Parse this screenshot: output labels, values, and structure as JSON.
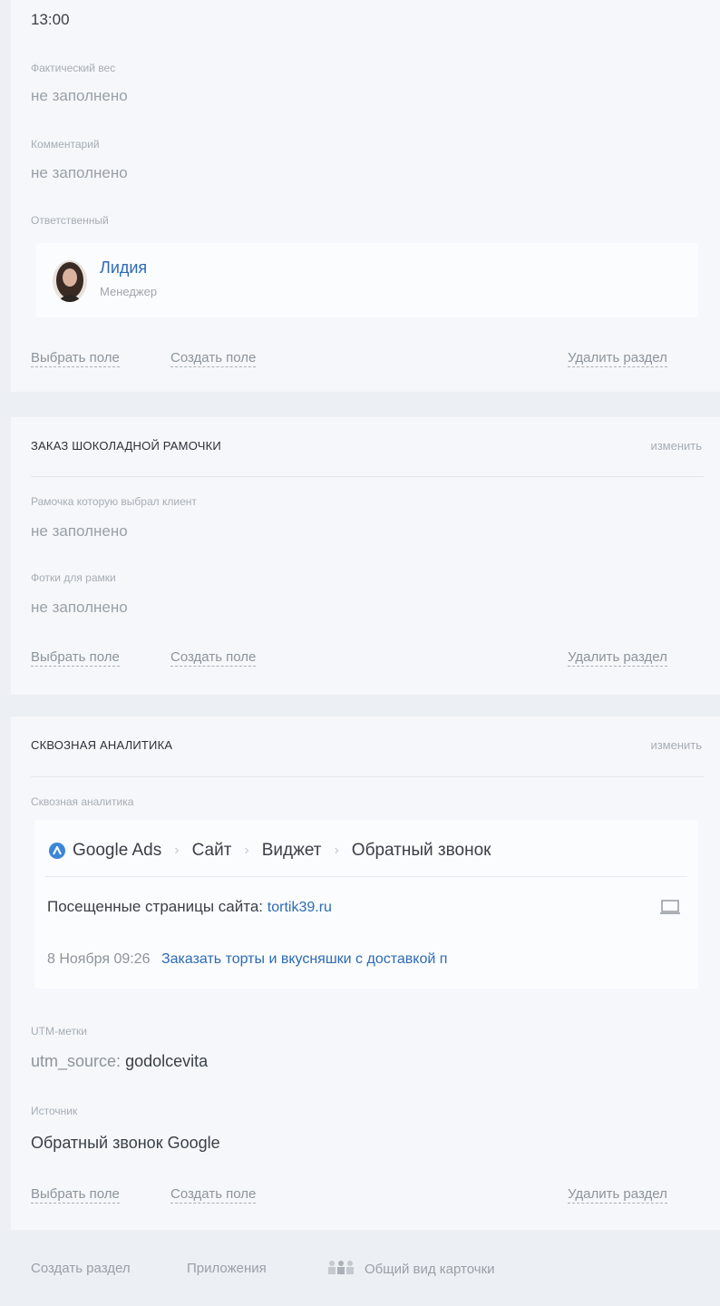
{
  "section_main": {
    "time": "13:00",
    "actual_weight_label": "Фактический вес",
    "actual_weight_value": "не заполнено",
    "comment_label": "Комментарий",
    "comment_value": "не заполнено",
    "responsible_label": "Ответственный",
    "responsible_name": "Лидия",
    "responsible_role": "Менеджер",
    "actions": {
      "select_field": "Выбрать поле",
      "create_field": "Создать поле",
      "delete_section": "Удалить раздел"
    }
  },
  "section_frame": {
    "title": "ЗАКАЗ ШОКОЛАДНОЙ РАМОЧКИ",
    "edit": "изменить",
    "frame_label": "Рамочка которую выбрал клиент",
    "frame_value": "не заполнено",
    "photo_label": "Фотки для рамки",
    "photo_value": "не заполнено",
    "actions": {
      "select_field": "Выбрать поле",
      "create_field": "Создать поле",
      "delete_section": "Удалить раздел"
    }
  },
  "section_analytics": {
    "title": "СКВОЗНАЯ АНАЛИТИКА",
    "edit": "изменить",
    "analytics_label": "Сквозная аналитика",
    "path": [
      "Google Ads",
      "Сайт",
      "Виджет",
      "Обратный звонок"
    ],
    "visited_pages_label": "Посещенные страницы сайта:",
    "visited_site": "tortik39.ru",
    "visit_time": "8 Ноября 09:26",
    "visit_page": "Заказать торты и вкусняшки с доставкой п",
    "utm_label": "UTM-метки",
    "utm_key": "utm_source:",
    "utm_value": "godolcevita",
    "source_label": "Источник",
    "source_value": "Обратный звонок Google",
    "actions": {
      "select_field": "Выбрать поле",
      "create_field": "Создать поле",
      "delete_section": "Удалить раздел"
    }
  },
  "footer": {
    "create_section": "Создать раздел",
    "applications": "Приложения",
    "card_overview": "Общий вид карточки"
  },
  "colors": {
    "accent": "#2d6bb5",
    "ads_icon": "#3c86d8"
  }
}
